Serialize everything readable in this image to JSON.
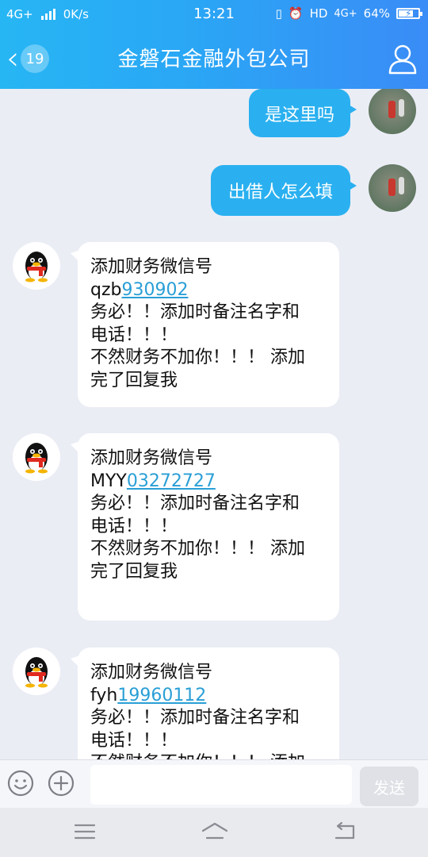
{
  "status_bar": {
    "network": "4G+",
    "speed": "0K/s",
    "time": "13:21",
    "hd": "HD",
    "network_right": "4G+",
    "battery": "64%"
  },
  "header": {
    "back_count": "19",
    "title": "金磐石金融外包公司"
  },
  "messages": {
    "out1": "是这里吗",
    "out2": "出借人怎么填",
    "in1": {
      "line1": "添加财务微信号",
      "id_prefix": "qzb",
      "id_link": "930902",
      "line3": "务必！！添加时备注名字和",
      "line4": "电话！！！",
      "line5": "不然财务不加你！！！ 添加",
      "line6": "完了回复我"
    },
    "in2": {
      "line1": "添加财务微信号",
      "id_prefix": "MYY",
      "id_link": "03272727",
      "line3": "务必！！添加时备注名字和",
      "line4": "电话！！！",
      "line5": "不然财务不加你！！！ 添加",
      "line6": "完了回复我"
    },
    "in3": {
      "line1": "添加财务微信号",
      "id_prefix": "fyh",
      "id_link": "19960112",
      "line3": "务必！！添加时备注名字和",
      "line4": "电话！！！",
      "line5": "不然财务不加你！！！ 添加"
    }
  },
  "input": {
    "send_label": "发送"
  },
  "colors": {
    "header_start": "#27b6f4",
    "header_end": "#3a8cf6",
    "bubble_out": "#2ab0f0",
    "link": "#2a9fd6"
  }
}
